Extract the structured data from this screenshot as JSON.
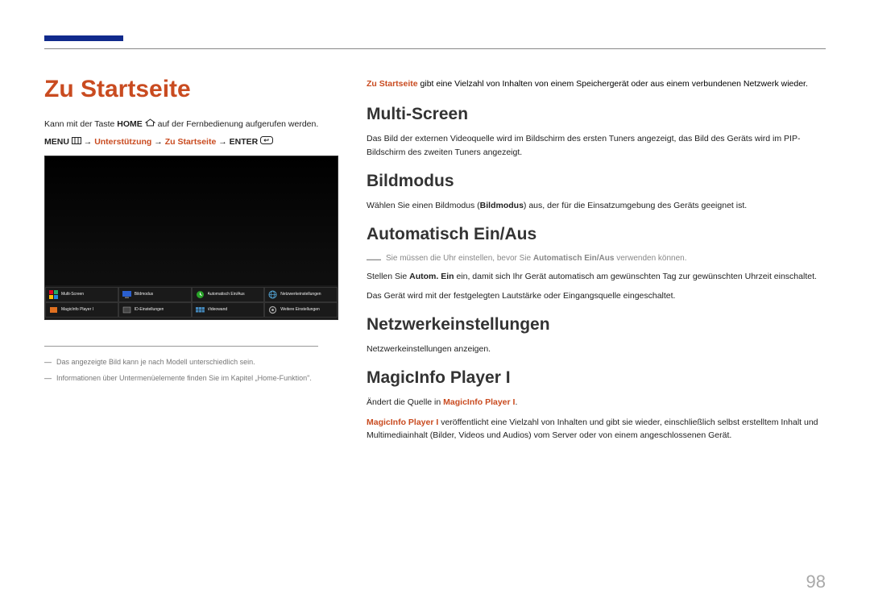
{
  "page_number": "98",
  "left": {
    "title": "Zu Startseite",
    "intro_pre": "Kann mit der Taste ",
    "intro_bold": "HOME",
    "intro_post": " auf der Fernbedienung aufgerufen werden.",
    "path_menu": "MENU",
    "path_arrow1": " → ",
    "path_support": "Unterstützung",
    "path_arrow2": " → ",
    "path_home": "Zu Startseite",
    "path_arrow3": " → ",
    "path_enter": "ENTER",
    "menu_items": {
      "r0c0": "Multi-Screen",
      "r0c1": "Bildmodus",
      "r0c2": "Automatisch Ein/Aus",
      "r0c3": "Netzwerkeinstellungen",
      "r1c0": "MagicInfo Player I",
      "r1c1": "ID-Einstellungen",
      "r1c2": "Videowand",
      "r1c3": "Weitere Einstellungen"
    },
    "footnote1": "Das angezeigte Bild kann je nach Modell unterschiedlich sein.",
    "footnote2": "Informationen über Untermenüelemente finden Sie im Kapitel „Home-Funktion\"."
  },
  "right": {
    "intro_orange": "Zu Startseite",
    "intro_rest": " gibt eine Vielzahl von Inhalten von einem Speichergerät oder aus einem verbundenen Netzwerk wieder.",
    "multi_screen": {
      "title": "Multi-Screen",
      "text": "Das Bild der externen Videoquelle wird im Bildschirm des ersten Tuners angezeigt, das Bild des Geräts wird im PIP-Bildschirm des zweiten Tuners angezeigt."
    },
    "bildmodus": {
      "title": "Bildmodus",
      "text_pre": "Wählen Sie einen Bildmodus (",
      "text_bold": "Bildmodus",
      "text_post": ") aus, der für die Einsatzumgebung des Geräts geeignet ist."
    },
    "auto": {
      "title": "Automatisch Ein/Aus",
      "note_pre": "Sie müssen die Uhr einstellen, bevor Sie ",
      "note_bold": "Automatisch Ein/Aus",
      "note_post": " verwenden können.",
      "p1_pre": "Stellen Sie ",
      "p1_bold": "Autom. Ein",
      "p1_post": " ein, damit sich Ihr Gerät automatisch am gewünschten Tag zur gewünschten Uhrzeit einschaltet.",
      "p2": "Das Gerät wird mit der festgelegten Lautstärke oder Eingangsquelle eingeschaltet."
    },
    "netzwerk": {
      "title": "Netzwerkeinstellungen",
      "text": "Netzwerkeinstellungen anzeigen."
    },
    "magic": {
      "title": "MagicInfo Player I",
      "p1_pre": "Ändert die Quelle in ",
      "p1_bold": "MagicInfo Player I",
      "p1_post": ".",
      "p2_bold": "MagicInfo Player I",
      "p2_rest": " veröffentlicht eine Vielzahl von Inhalten und gibt sie wieder, einschließlich selbst erstelltem Inhalt und Multimediainhalt (Bilder, Videos und Audios) vom Server oder von einem angeschlossenen Gerät."
    }
  }
}
